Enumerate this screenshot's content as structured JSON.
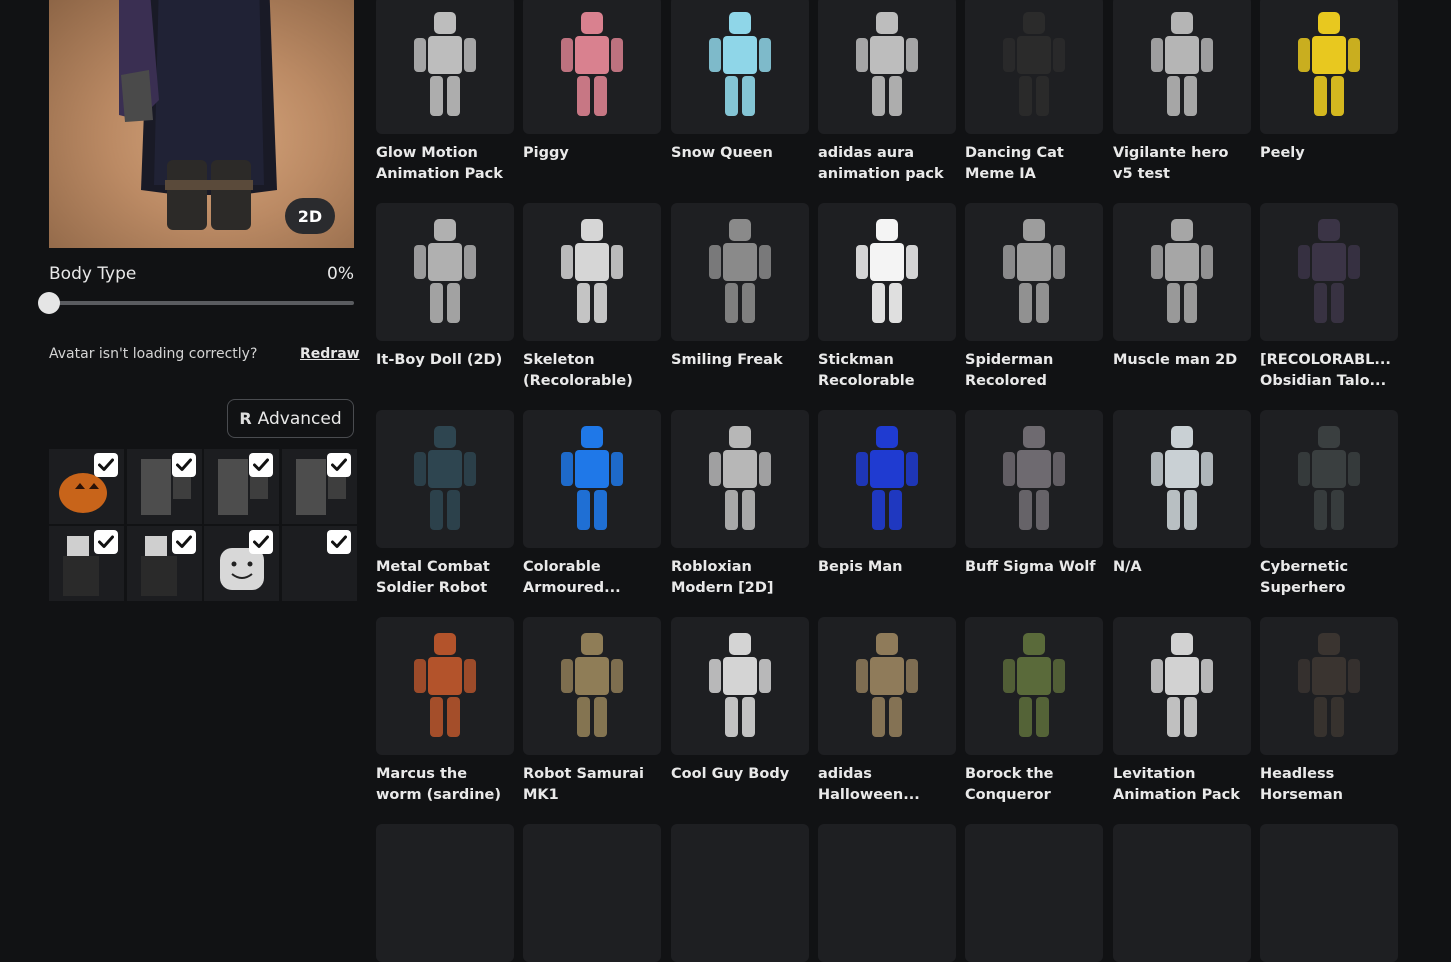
{
  "avatar": {
    "view_toggle_label": "2D",
    "body_type_label": "Body Type",
    "body_type_value": "0%",
    "body_type_fraction": 0,
    "loading_text": "Avatar isn't loading correctly?",
    "redraw_label": "Redraw",
    "advanced_label": "Advanced"
  },
  "worn_items": [
    {
      "icon": "pumpkin-head",
      "checked": true
    },
    {
      "icon": "gray-body-part",
      "checked": true
    },
    {
      "icon": "gray-body-part",
      "checked": true
    },
    {
      "icon": "gray-body-part",
      "checked": true
    },
    {
      "icon": "dark-figure",
      "checked": true
    },
    {
      "icon": "dark-figure",
      "checked": true
    },
    {
      "icon": "smiley-head",
      "checked": true
    },
    {
      "icon": "empty",
      "checked": true
    }
  ],
  "catalog": {
    "items": [
      {
        "name": "Glow Motion Animation Pack",
        "color": "#bdbdbd"
      },
      {
        "name": "Piggy",
        "color": "#d9818f"
      },
      {
        "name": "Snow Queen",
        "color": "#8fd6e8"
      },
      {
        "name": "adidas aura animation pack",
        "color": "#bdbdbd"
      },
      {
        "name": "Dancing Cat Meme IA",
        "color": "#2b2b2b"
      },
      {
        "name": "Vigilante hero v5 test",
        "color": "#b5b5b5"
      },
      {
        "name": "Peely",
        "color": "#e8c81f"
      },
      {
        "name": "It-Boy Doll (2D)",
        "color": "#b0b0b0"
      },
      {
        "name": "Skeleton (Recolorable)",
        "color": "#d6d6d6"
      },
      {
        "name": "Smiling Freak",
        "color": "#8a8a8a"
      },
      {
        "name": "Stickman Recolorable",
        "color": "#f4f4f4"
      },
      {
        "name": "Spiderman Recolored",
        "color": "#9d9d9d"
      },
      {
        "name": "Muscle man 2D",
        "color": "#a6a6a6"
      },
      {
        "name": "[RECOLORABL... Obsidian Talo...",
        "color": "#3b3446"
      },
      {
        "name": "Metal Combat Soldier Robot",
        "color": "#2e4550"
      },
      {
        "name": "Colorable Armoured...",
        "color": "#1f78e8"
      },
      {
        "name": "Robloxian Modern [2D]",
        "color": "#b7b7b7"
      },
      {
        "name": "Bepis Man",
        "color": "#1f3bd1"
      },
      {
        "name": "Buff Sigma Wolf",
        "color": "#6e6a70"
      },
      {
        "name": "N/A",
        "color": "#c9d0d4"
      },
      {
        "name": "Cybernetic Superhero",
        "color": "#3a3f40"
      },
      {
        "name": "Marcus the worm (sardine)",
        "color": "#b3532b"
      },
      {
        "name": "Robot Samurai MK1",
        "color": "#8f7d57"
      },
      {
        "name": "Cool Guy Body",
        "color": "#d4d4d4"
      },
      {
        "name": "adidas Halloween...",
        "color": "#8f7b5a"
      },
      {
        "name": "Borock the Conqueror",
        "color": "#5a6a3a"
      },
      {
        "name": "Levitation Animation Pack",
        "color": "#d2d2d2"
      },
      {
        "name": "Headless Horseman",
        "color": "#3a3430"
      },
      {
        "name": "",
        "color": "#1e1f22"
      },
      {
        "name": "",
        "color": "#1e1f22"
      },
      {
        "name": "",
        "color": "#1e1f22"
      },
      {
        "name": "",
        "color": "#1e1f22"
      },
      {
        "name": "",
        "color": "#1e1f22"
      },
      {
        "name": "",
        "color": "#1e1f22"
      },
      {
        "name": "",
        "color": "#1e1f22"
      }
    ]
  }
}
